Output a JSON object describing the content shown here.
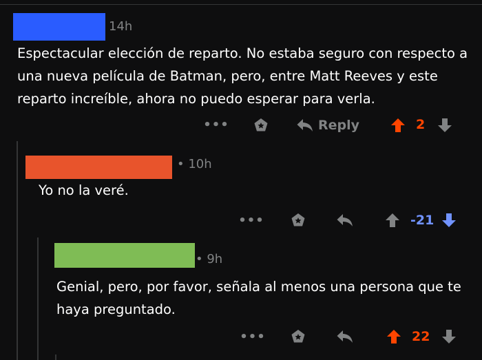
{
  "colors": {
    "background": "#0e0e0f",
    "upvote_orange": "#ff4500",
    "downvote_blue": "#7193ff",
    "muted_gray": "#818384",
    "text_white": "#ffffff",
    "redact_blue": "#2a5cff",
    "redact_orange": "#e8542c",
    "redact_green": "#7fbc55"
  },
  "comments": [
    {
      "meta": "14h",
      "text": "Espectacular elección de reparto. No estaba seguro con respecto a una nueva película de Batman, pero, entre Matt Reeves y este reparto increíble, ahora no puedo esperar para verla.",
      "more_label": "•••",
      "reply_label": "Reply",
      "score": "2",
      "vote_state": "upvoted"
    },
    {
      "meta": "• 10h",
      "text": "Yo no la veré.",
      "more_label": "•••",
      "score": "-21",
      "vote_state": "downvoted"
    },
    {
      "meta": "• 9h",
      "text": "Genial, pero, por favor, señala al menos una persona que te haya preguntado.",
      "more_label": "•••",
      "score": "22",
      "vote_state": "upvoted"
    }
  ]
}
